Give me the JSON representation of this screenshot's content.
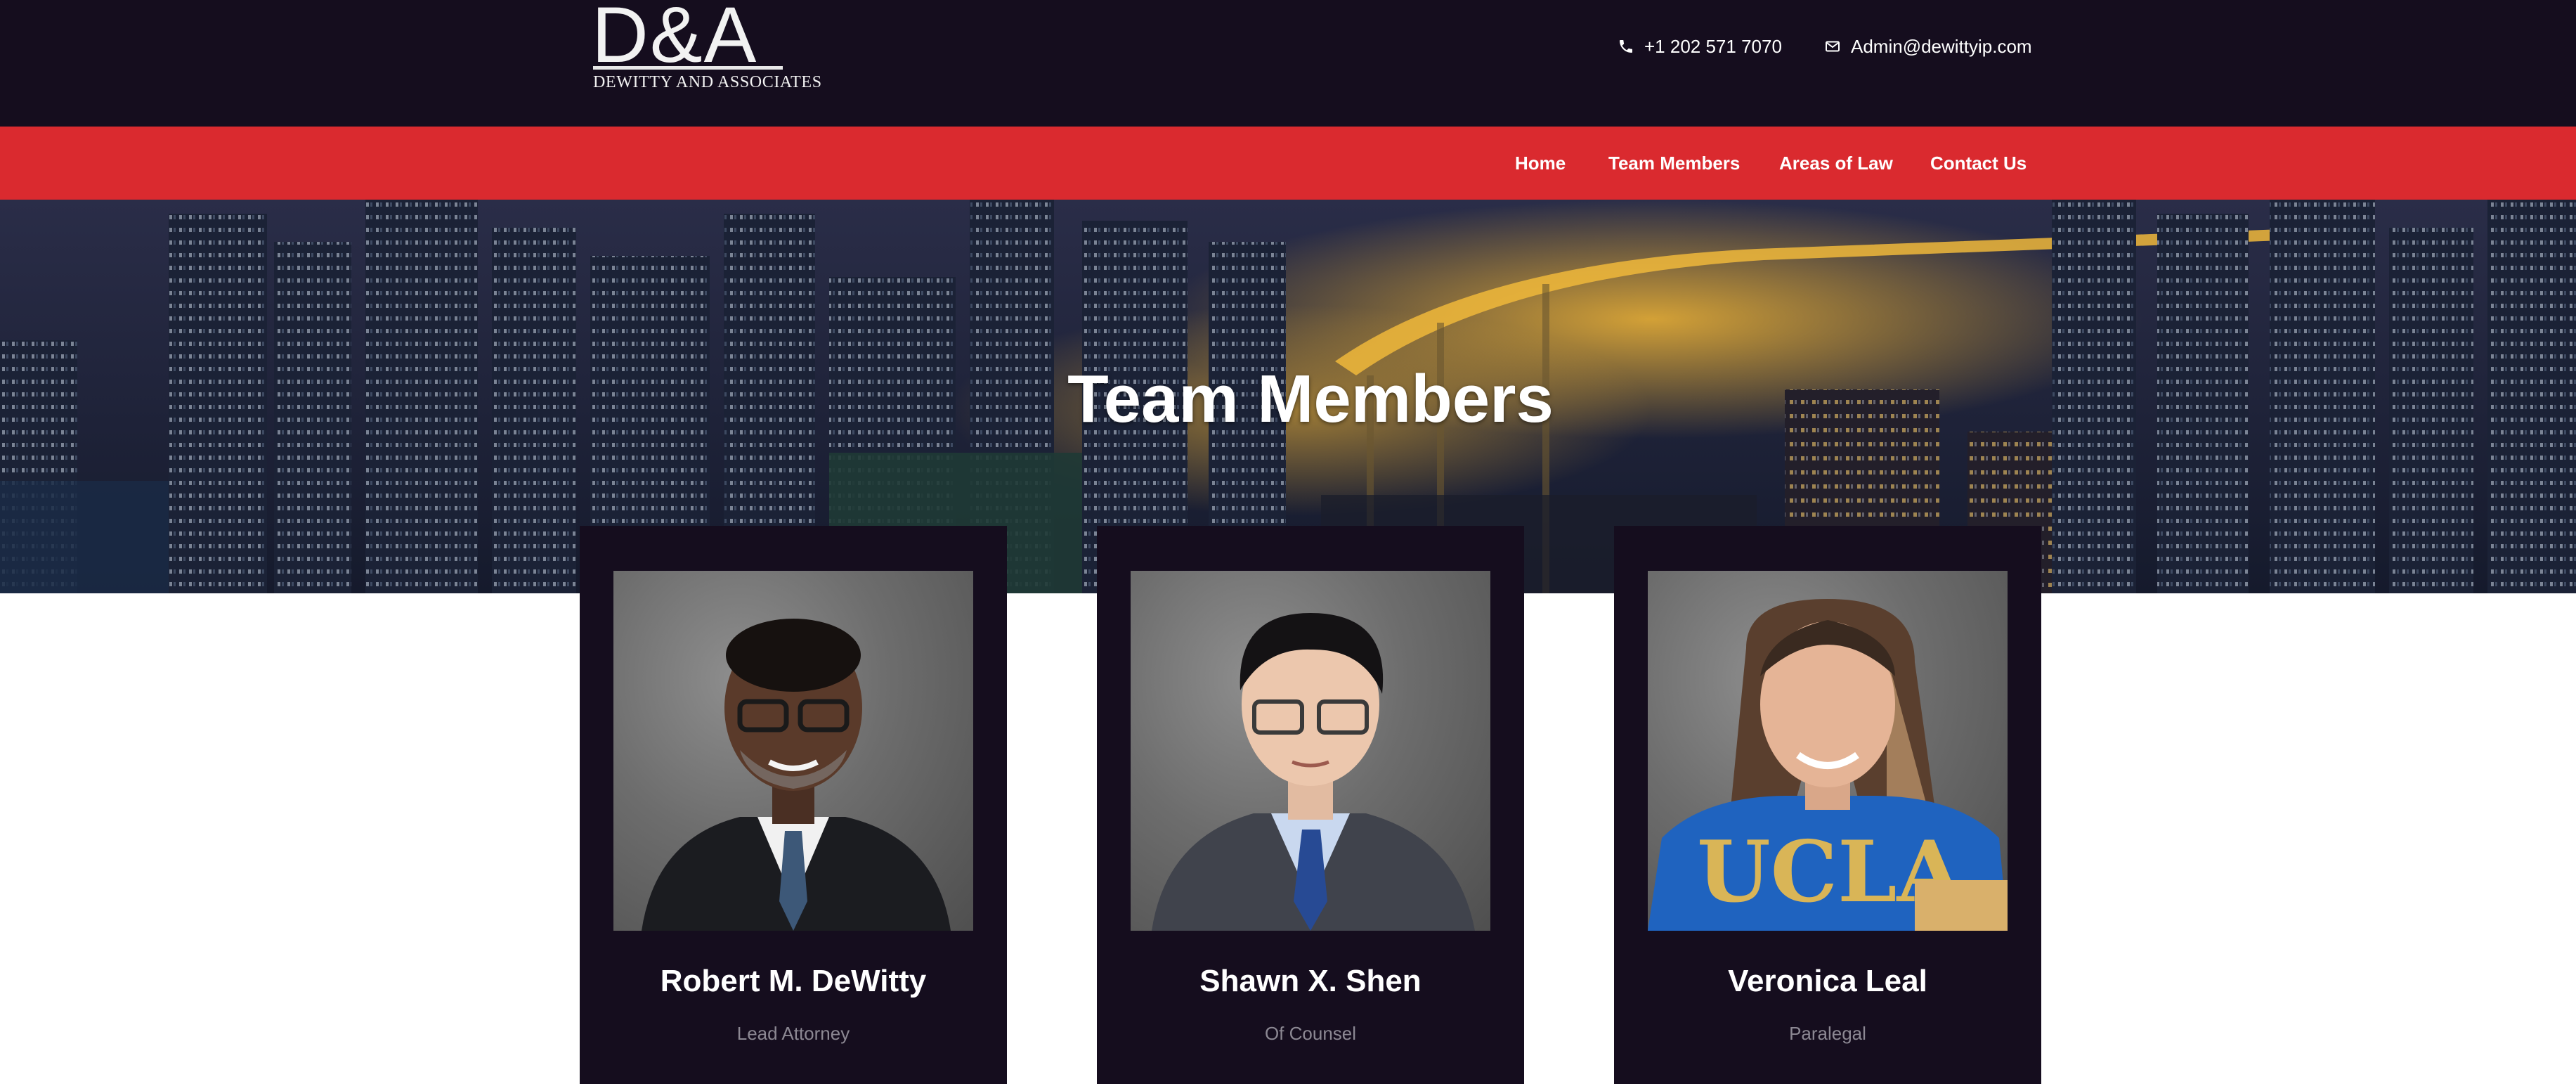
{
  "header": {
    "logo_mark": "D&A",
    "logo_name": "DEWITTY AND ASSOCIATES",
    "phone": "+1 202 571 7070",
    "email": "Admin@dewittyip.com",
    "phone_icon": "phone-icon",
    "email_icon": "envelope-icon"
  },
  "nav": {
    "items": [
      {
        "label": "Home"
      },
      {
        "label": "Team Members"
      },
      {
        "label": "Areas of Law"
      },
      {
        "label": "Contact Us"
      }
    ]
  },
  "hero": {
    "title": "Team Members"
  },
  "team": {
    "members": [
      {
        "name": "Robert M. DeWitty",
        "role": "Lead Attorney"
      },
      {
        "name": "Shawn X. Shen",
        "role": "Of Counsel"
      },
      {
        "name": "Veronica Leal",
        "role": "Paralegal"
      }
    ]
  },
  "colors": {
    "header_bg": "#150d1e",
    "nav_bg": "#da2a2f",
    "card_bg": "#150d1e",
    "role_text": "#8c8893",
    "page_bg": "#ffffff"
  }
}
